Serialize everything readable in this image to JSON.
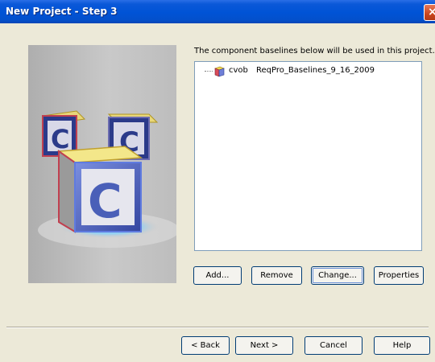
{
  "window": {
    "title": "New Project - Step 3",
    "close_icon": "close-icon"
  },
  "art": {
    "description_icon": "clearcase-blocks-illustration",
    "block_letter": "C"
  },
  "baselines": {
    "description": "The component baselines below will be used in this project.",
    "items": [
      {
        "component": "cvob",
        "baseline": "ReqPro_Baselines_9_16_2009",
        "icon": "component-icon"
      }
    ]
  },
  "buttons": {
    "add": "Add...",
    "remove": "Remove",
    "change": "Change...",
    "properties": "Properties"
  },
  "nav": {
    "back": "< Back",
    "next": "Next >",
    "cancel": "Cancel",
    "help": "Help"
  },
  "colors": {
    "titlebar": "#0053d6",
    "background": "#ece9d8",
    "tree_border": "#7f9db9",
    "button_border": "#003c74"
  }
}
